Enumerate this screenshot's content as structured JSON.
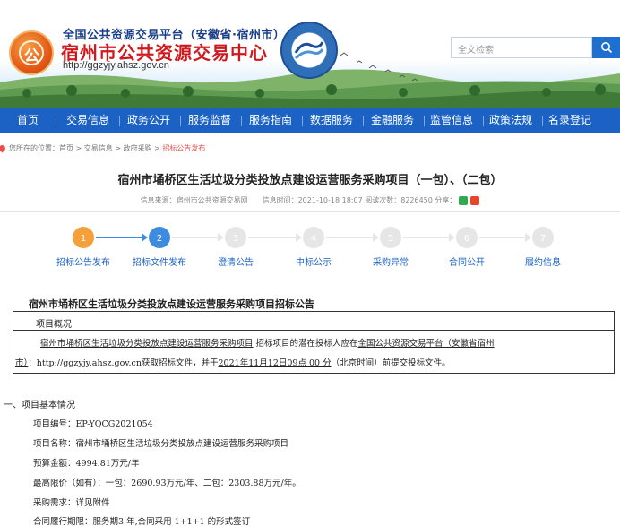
{
  "header": {
    "platform": "全国公共资源交易平台（安徽省·宿州市）",
    "center": "宿州市公共资源交易中心",
    "url": "http://ggzyjy.ahsz.gov.cn",
    "search_placeholder": "全文检索"
  },
  "nav": [
    "首页",
    "交易信息",
    "政务公开",
    "服务监督",
    "服务指南",
    "数据服务",
    "金融服务",
    "监管信息",
    "政策法规",
    "名录登记"
  ],
  "breadcrumb": {
    "prefix": "您所在的位置：首页 > 交易信息 > 政府采购 > ",
    "current": "招标公告发布"
  },
  "article": {
    "title": "宿州市埇桥区生活垃圾分类投放点建设运营服务采购项目（一包）、（二包）",
    "meta": "信息来源：宿州市公共资源交易网　　信息时间：2021-10-18 18:07 阅读次数：8226450 分享："
  },
  "steps": [
    {
      "num": "1",
      "label": "招标公告发布",
      "state": "done"
    },
    {
      "num": "2",
      "label": "招标文件发布",
      "state": "current"
    },
    {
      "num": "3",
      "label": "澄清公告",
      "state": "pending"
    },
    {
      "num": "4",
      "label": "中标公示",
      "state": "pending"
    },
    {
      "num": "5",
      "label": "采购异常",
      "state": "pending"
    },
    {
      "num": "6",
      "label": "合同公开",
      "state": "pending"
    },
    {
      "num": "7",
      "label": "履约信息",
      "state": "pending"
    }
  ],
  "announcement": {
    "title": "宿州市埇桥区生活垃圾分类投放点建设运营服务采购项目招标公告",
    "overview_label": "项目概况",
    "overview_p1_a": "宿州市埇桥区生活垃圾分类投放点建设运营服务采购项目",
    "overview_p1_b": " 招标项目的潜在投标人应在",
    "overview_p1_c": "全国公共资源交易平台（安徽省宿州",
    "overview_p2_a": "市）",
    "overview_p2_b": "：http://ggzyjy.ahsz.gov.cn",
    "overview_p2_c": "获取招标文件，并于",
    "overview_p2_d": "2021年11月12日09点 00 分",
    "overview_p2_e": "（北京时间）前提交投标文件。",
    "section1": "一、项目基本情况",
    "lines": [
      "项目编号：EP-YQCG2021054",
      "项目名称：宿州市埇桥区生活垃圾分类投放点建设运营服务采购项目",
      "预算金额：4994.81万元/年",
      "最高限价（如有）：一包：2690.93万元/年、二包：2303.88万元/年。",
      "采购需求：详见附件",
      "合同履行期限：服务期3 年,合同采用 1+1+1 的形式签订"
    ]
  },
  "colors": {
    "nav_bg": "#1b62c4",
    "step_done": "#f5a03a",
    "step_current": "#3f8be0",
    "step_pending": "#e6e6e6",
    "breadcrumb_current": "#e94e4e"
  }
}
